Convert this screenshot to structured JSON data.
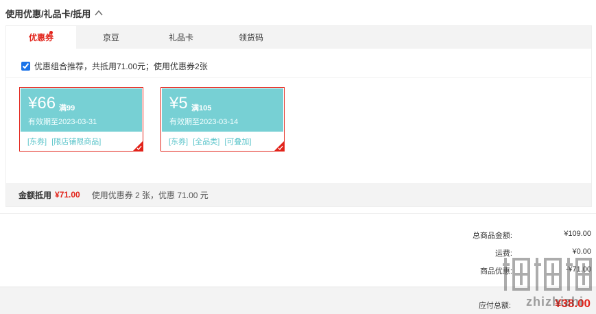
{
  "section": {
    "title": "使用优惠/礼品卡/抵用"
  },
  "tabs": [
    {
      "label": "优惠券",
      "active": true,
      "dot": true
    },
    {
      "label": "京豆",
      "active": false
    },
    {
      "label": "礼品卡",
      "active": false
    },
    {
      "label": "领货码",
      "active": false
    }
  ],
  "recommend": {
    "checked": true,
    "text": "优惠组合推荐，共抵用71.00元；使用优惠券2张"
  },
  "coupons": [
    {
      "amount": "¥66",
      "condition": "满99",
      "expiry": "有效期至2023-03-31",
      "tags": [
        "[东券]",
        "[限店铺限商品]"
      ],
      "selected": true
    },
    {
      "amount": "¥5",
      "condition": "满105",
      "expiry": "有效期至2023-03-14",
      "tags": [
        "[东券]",
        "[全品类]",
        "[可叠加]"
      ],
      "selected": true
    }
  ],
  "deduction": {
    "label": "金额抵用",
    "amount": "¥71.00",
    "desc": "使用优惠券 2 张，优惠 71.00 元"
  },
  "summary": [
    {
      "label": "总商品金额:",
      "value": "¥109.00"
    },
    {
      "label": "运费:",
      "value": "¥0.00"
    },
    {
      "label": "商品优惠:",
      "value": "-¥71.00"
    }
  ],
  "total": {
    "label": "应付总额:",
    "value": "¥38.00"
  },
  "watermark": {
    "text": "zhizhizhi"
  },
  "colors": {
    "accent": "#e2231a",
    "coupon_bg": "#77d0d4",
    "tag_text": "#5bc4ca",
    "tab_bar_bg": "#f3f3f3"
  }
}
